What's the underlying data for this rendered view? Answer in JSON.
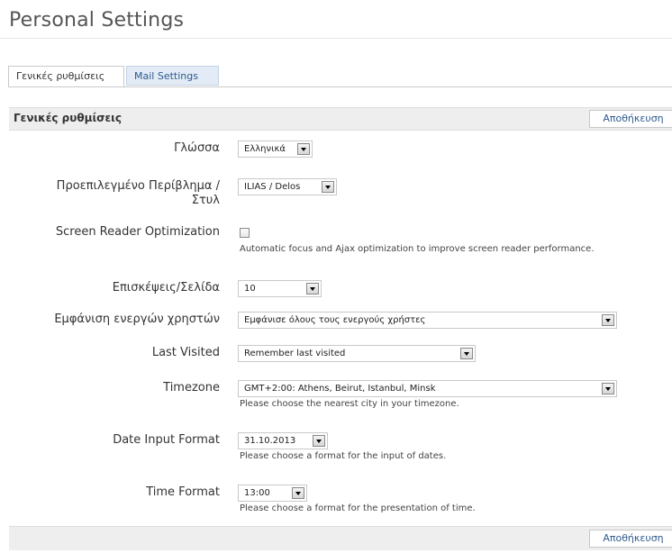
{
  "page": {
    "title": "Personal Settings"
  },
  "tabs": [
    {
      "label": "Γενικές ρυθμίσεις",
      "active": true
    },
    {
      "label": "Mail Settings",
      "active": false
    }
  ],
  "form": {
    "title": "Γενικές ρυθμίσεις",
    "save_label": "Αποθήκευση",
    "fields": {
      "language": {
        "label": "Γλώσσα",
        "value": "Ελληνικά"
      },
      "skin": {
        "label_line1": "Προεπιλεγμένο Περίβλημα /",
        "label_line2": "Στυλ",
        "value": "ILIAS / Delos"
      },
      "screen_reader": {
        "label": "Screen Reader Optimization",
        "checked": false,
        "help": "Automatic focus and Ajax optimization to improve screen reader performance."
      },
      "hits_per_page": {
        "label": "Επισκέψεις/Σελίδα",
        "value": "10"
      },
      "show_users_online": {
        "label": "Εμφάνιση ενεργών χρηστών",
        "value": "Εμφάνισε όλους τους ενεργούς χρήστες"
      },
      "last_visited": {
        "label": "Last Visited",
        "value": "Remember last visited"
      },
      "timezone": {
        "label": "Timezone",
        "value": "GMT+2:00: Athens, Beirut, Istanbul, Minsk",
        "help": "Please choose the nearest city in your timezone."
      },
      "date_format": {
        "label": "Date Input Format",
        "value": "31.10.2013",
        "help": "Please choose a format for the input of dates."
      },
      "time_format": {
        "label": "Time Format",
        "value": "13:00",
        "help": "Please choose a format for the presentation of time."
      }
    }
  },
  "colors": {
    "header_bg": "#eeeeee",
    "link": "#2d5a8f",
    "tab_inactive_bg": "#e3ecf6"
  }
}
